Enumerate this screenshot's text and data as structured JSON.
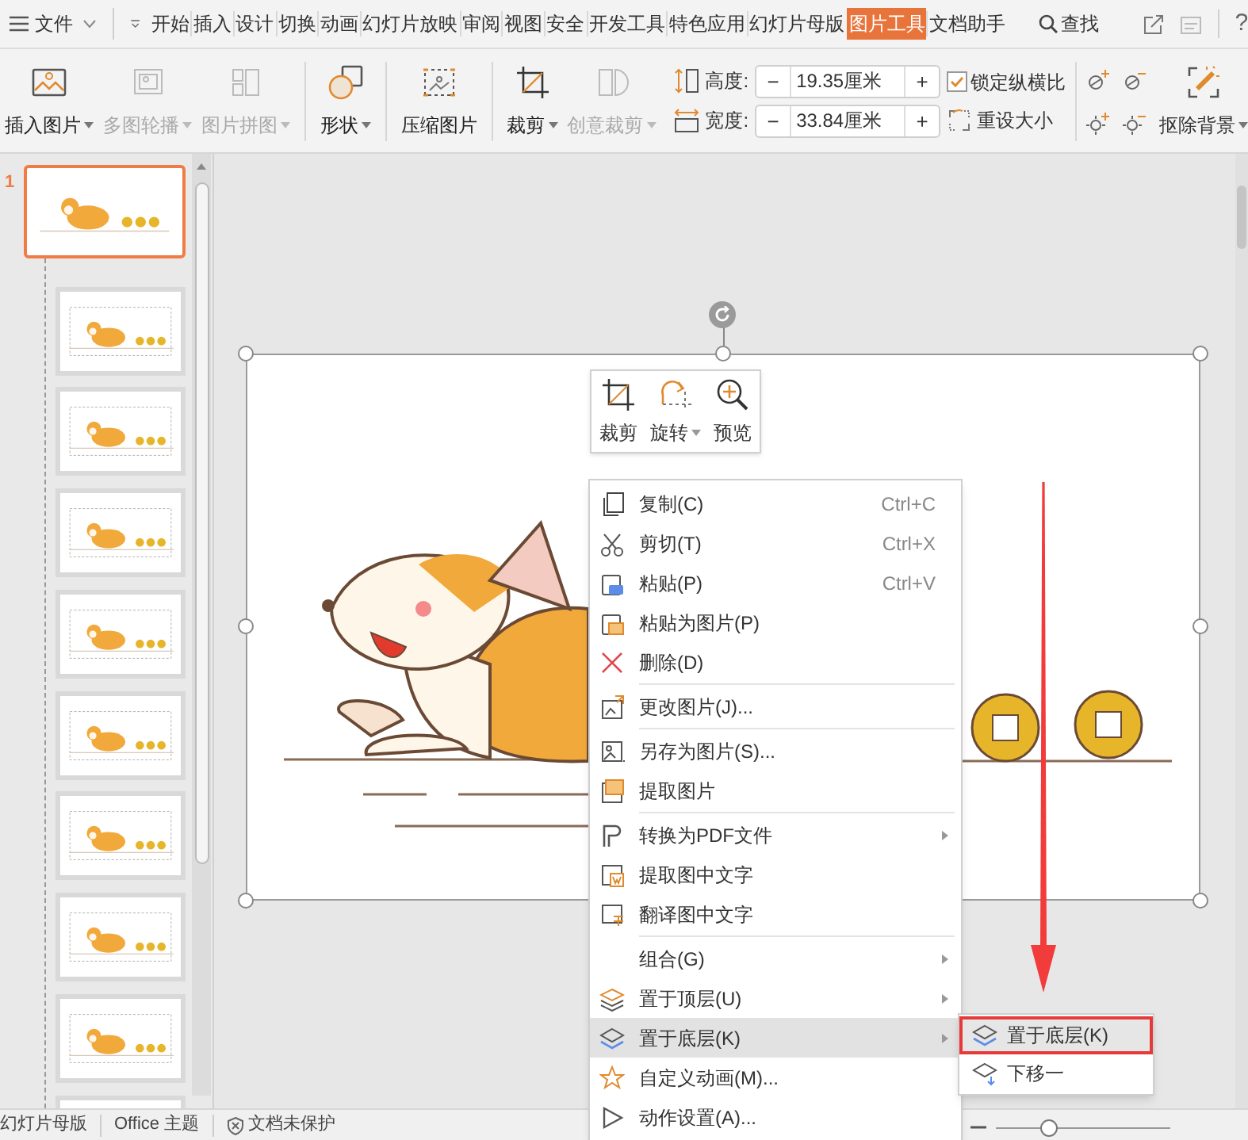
{
  "menu_bar": {
    "file_menu": "文件",
    "tabs": [
      {
        "label": "开始",
        "selected": false
      },
      {
        "label": "插入",
        "selected": false
      },
      {
        "label": "设计",
        "selected": false
      },
      {
        "label": "切换",
        "selected": false
      },
      {
        "label": "动画",
        "selected": false
      },
      {
        "label": "幻灯片放映",
        "selected": false
      },
      {
        "label": "审阅",
        "selected": false
      },
      {
        "label": "视图",
        "selected": false
      },
      {
        "label": "安全",
        "selected": false
      },
      {
        "label": "开发工具",
        "selected": false
      },
      {
        "label": "特色应用",
        "selected": false
      },
      {
        "label": "幻灯片母版",
        "selected": false
      },
      {
        "label": "图片工具",
        "selected": true
      },
      {
        "label": "文档助手",
        "selected": false
      }
    ],
    "search": "查找",
    "help": "?"
  },
  "ribbon": {
    "buttons": [
      {
        "label": "插入图片",
        "disabled": false,
        "dropdown": true
      },
      {
        "label": "多图轮播",
        "disabled": true,
        "dropdown": true
      },
      {
        "label": "图片拼图",
        "disabled": true,
        "dropdown": true
      },
      {
        "label": "形状",
        "disabled": false,
        "dropdown": true
      },
      {
        "label": "压缩图片",
        "disabled": false,
        "dropdown": false
      },
      {
        "label": "裁剪",
        "disabled": false,
        "dropdown": true
      },
      {
        "label": "创意裁剪",
        "disabled": true,
        "dropdown": true
      }
    ],
    "size_fields": [
      {
        "label": "高度:",
        "value": "19.35厘米",
        "minus": "−",
        "plus": "+"
      },
      {
        "label": "宽度:",
        "value": "33.84厘米",
        "minus": "−",
        "plus": "+"
      }
    ],
    "lock_ratio": {
      "label": "锁定纵横比",
      "checked": true
    },
    "reset_size": "重设大小",
    "remove_background": "抠除背景"
  },
  "slides": [
    {
      "number": "1",
      "selected": true
    },
    {
      "selected": false
    },
    {
      "selected": false
    },
    {
      "selected": false
    },
    {
      "selected": false
    },
    {
      "selected": false
    },
    {
      "selected": false
    },
    {
      "selected": false
    },
    {
      "selected": false
    },
    {
      "selected": false
    }
  ],
  "mini_toolbar": [
    {
      "label": "裁剪",
      "dropdown": false
    },
    {
      "label": "旋转",
      "dropdown": true
    },
    {
      "label": "预览",
      "dropdown": false
    }
  ],
  "context_menu": [
    {
      "label": "复制(C)",
      "shortcut": "Ctrl+C",
      "submenu": false,
      "selected": false
    },
    {
      "label": "剪切(T)",
      "shortcut": "Ctrl+X",
      "submenu": false,
      "selected": false
    },
    {
      "label": "粘贴(P)",
      "shortcut": "Ctrl+V",
      "submenu": false,
      "selected": false
    },
    {
      "label": "粘贴为图片(P)",
      "submenu": false,
      "selected": false
    },
    {
      "label": "删除(D)",
      "submenu": false,
      "selected": false
    },
    {
      "label": "更改图片(J)...",
      "submenu": false,
      "selected": false,
      "separator_before": true
    },
    {
      "label": "另存为图片(S)...",
      "submenu": false,
      "selected": false,
      "separator_before": true
    },
    {
      "label": "提取图片",
      "submenu": false,
      "selected": false
    },
    {
      "label": "转换为PDF文件",
      "submenu": true,
      "selected": false,
      "separator_before": true
    },
    {
      "label": "提取图中文字",
      "submenu": false,
      "selected": false
    },
    {
      "label": "翻译图中文字",
      "submenu": false,
      "selected": false
    },
    {
      "label": "组合(G)",
      "submenu": true,
      "selected": false,
      "separator_before": true
    },
    {
      "label": "置于顶层(U)",
      "submenu": true,
      "selected": false
    },
    {
      "label": "置于底层(K)",
      "submenu": true,
      "selected": true
    },
    {
      "label": "自定义动画(M)...",
      "submenu": false,
      "selected": false
    },
    {
      "label": "动作设置(A)...",
      "submenu": false,
      "selected": false
    }
  ],
  "submenu": [
    {
      "label": "置于底层(K)",
      "selected": true
    },
    {
      "label": "下移一",
      "selected": false
    }
  ],
  "status_bar": [
    "幻灯片母版",
    "Office 主题",
    "文档未保护"
  ],
  "zoom_slider": {
    "level": 0.28
  }
}
